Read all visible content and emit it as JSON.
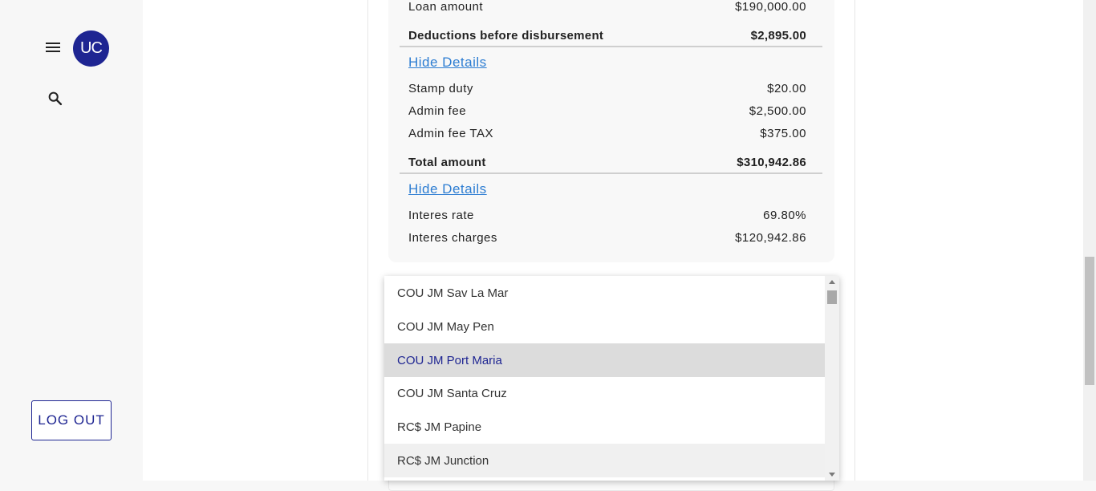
{
  "sidebar": {
    "avatar_initials": "UC",
    "logout_label": "LOG OUT",
    "menu_icon": "hamburger-menu-icon",
    "search_icon": "search-icon"
  },
  "summary": {
    "loan_amount_label": "Loan amount",
    "loan_amount_value": "$190,000.00",
    "deductions_label": "Deductions before disbursement",
    "deductions_value": "$2,895.00",
    "hide_details_1": "Hide Details",
    "stamp_duty_label": "Stamp duty",
    "stamp_duty_value": "$20.00",
    "admin_fee_label": "Admin fee",
    "admin_fee_value": "$2,500.00",
    "admin_fee_tax_label": "Admin fee TAX",
    "admin_fee_tax_value": "$375.00",
    "total_label": "Total amount",
    "total_value": "$310,942.86",
    "hide_details_2": "Hide Details",
    "interest_rate_label": "Interes rate",
    "interest_rate_value": "69.80%",
    "interest_charges_label": "Interes charges",
    "interest_charges_value": "$120,942.86"
  },
  "dropdown": {
    "options": [
      "COU JM Sav La Mar",
      "COU JM May Pen",
      "COU JM Port Maria",
      "COU JM Santa Cruz",
      "RC$ JM Papine",
      "RC$ JM Junction"
    ],
    "selected_index": 2,
    "scroll_up_icon": "scroll-up-arrow-icon",
    "scroll_down_icon": "scroll-down-arrow-icon"
  },
  "colors": {
    "brand": "#1e2592",
    "link": "#2d7dd2",
    "selected_bg": "#dcdcdc"
  }
}
